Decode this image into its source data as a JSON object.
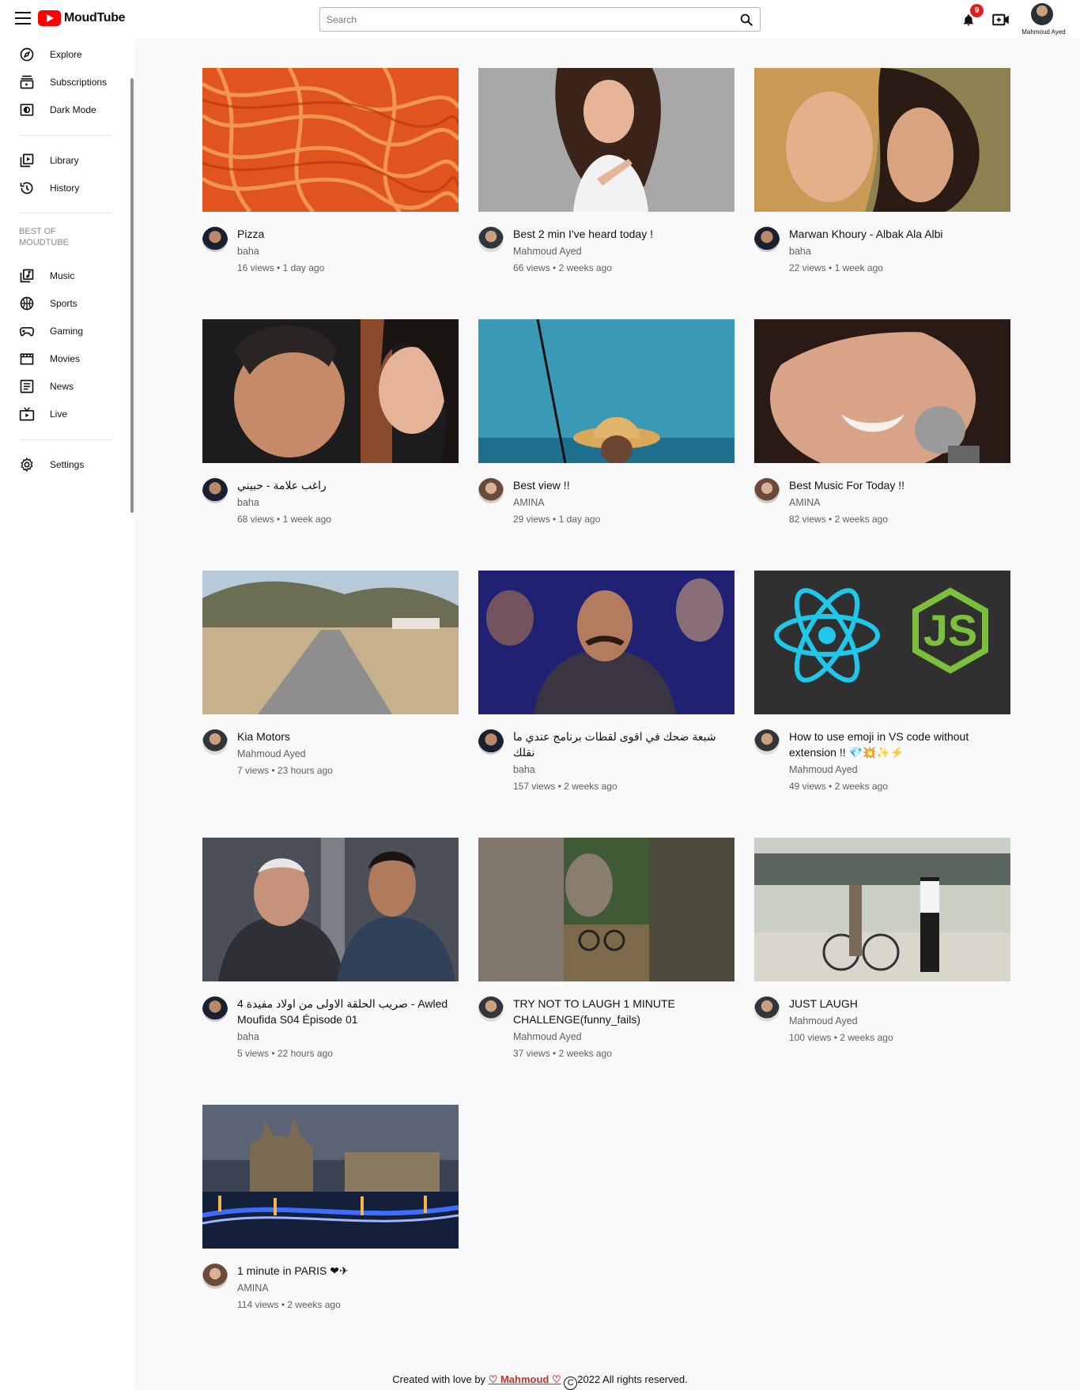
{
  "header": {
    "app_name": "MoudTube",
    "search_placeholder": "Search",
    "notification_count": "9",
    "user_name": "Mahmoud Ayed"
  },
  "sidebar": {
    "items_top": [
      {
        "label": "Explore",
        "icon": "compass-icon"
      },
      {
        "label": "Subscriptions",
        "icon": "subscriptions-icon"
      },
      {
        "label": "Dark Mode",
        "icon": "dark-mode-icon"
      }
    ],
    "items_mid": [
      {
        "label": "Library",
        "icon": "library-icon"
      },
      {
        "label": "History",
        "icon": "history-icon"
      }
    ],
    "section_heading": "BEST OF MOUDTUBE",
    "items_best": [
      {
        "label": "Music",
        "icon": "music-icon"
      },
      {
        "label": "Sports",
        "icon": "sports-icon"
      },
      {
        "label": "Gaming",
        "icon": "gaming-icon"
      },
      {
        "label": "Movies",
        "icon": "movies-icon"
      },
      {
        "label": "News",
        "icon": "news-icon"
      },
      {
        "label": "Live",
        "icon": "live-icon"
      }
    ],
    "settings_label": "Settings"
  },
  "videos": [
    {
      "title": "Pizza",
      "channel": "baha",
      "views": "16 views",
      "age": "1 day ago"
    },
    {
      "title": "Best 2 min I've heard today !",
      "channel": "Mahmoud Ayed",
      "views": "66 views",
      "age": "2 weeks ago"
    },
    {
      "title": "Marwan Khoury - Albak Ala Albi",
      "channel": "baha",
      "views": "22 views",
      "age": "1 week ago"
    },
    {
      "title": "راغب علامة - حبيني",
      "channel": "baha",
      "views": "68 views",
      "age": "1 week ago"
    },
    {
      "title": "Best view !!",
      "channel": "AMINA",
      "views": "29 views",
      "age": "1 day ago"
    },
    {
      "title": "Best Music For Today !!",
      "channel": "AMINA",
      "views": "82 views",
      "age": "2 weeks ago"
    },
    {
      "title": "Kia Motors",
      "channel": "Mahmoud Ayed",
      "views": "7 views",
      "age": "23 hours ago"
    },
    {
      "title": "شبعة ضحك في اقوى لقطات برنامج عندي ما نقلك",
      "channel": "baha",
      "views": "157 views",
      "age": "2 weeks ago"
    },
    {
      "title": "How to use emoji in VS code without extension !! 💎💥✨⚡",
      "channel": "Mahmoud Ayed",
      "views": "49 views",
      "age": "2 weeks ago"
    },
    {
      "title": "4 صريب الحلقة الاولى من اولاد مفيدة - Awled Moufida S04 Épisode 01",
      "channel": "baha",
      "views": "5 views",
      "age": "22 hours ago"
    },
    {
      "title": "TRY NOT TO LAUGH 1 MINUTE CHALLENGE(funny_fails)",
      "channel": "Mahmoud Ayed",
      "views": "37 views",
      "age": "2 weeks ago"
    },
    {
      "title": "JUST LAUGH",
      "channel": "Mahmoud Ayed",
      "views": "100 views",
      "age": "2 weeks ago"
    },
    {
      "title": "1 minute in PARIS ❤✈",
      "channel": "AMINA",
      "views": "114 views",
      "age": "2 weeks ago"
    }
  ],
  "stats_separator": " • ",
  "footer": {
    "prefix": "Created with love by ",
    "author": "♡ Mahmoud ♡",
    "copyright_symbol": "C",
    "suffix": "2022 All rights reserved."
  }
}
